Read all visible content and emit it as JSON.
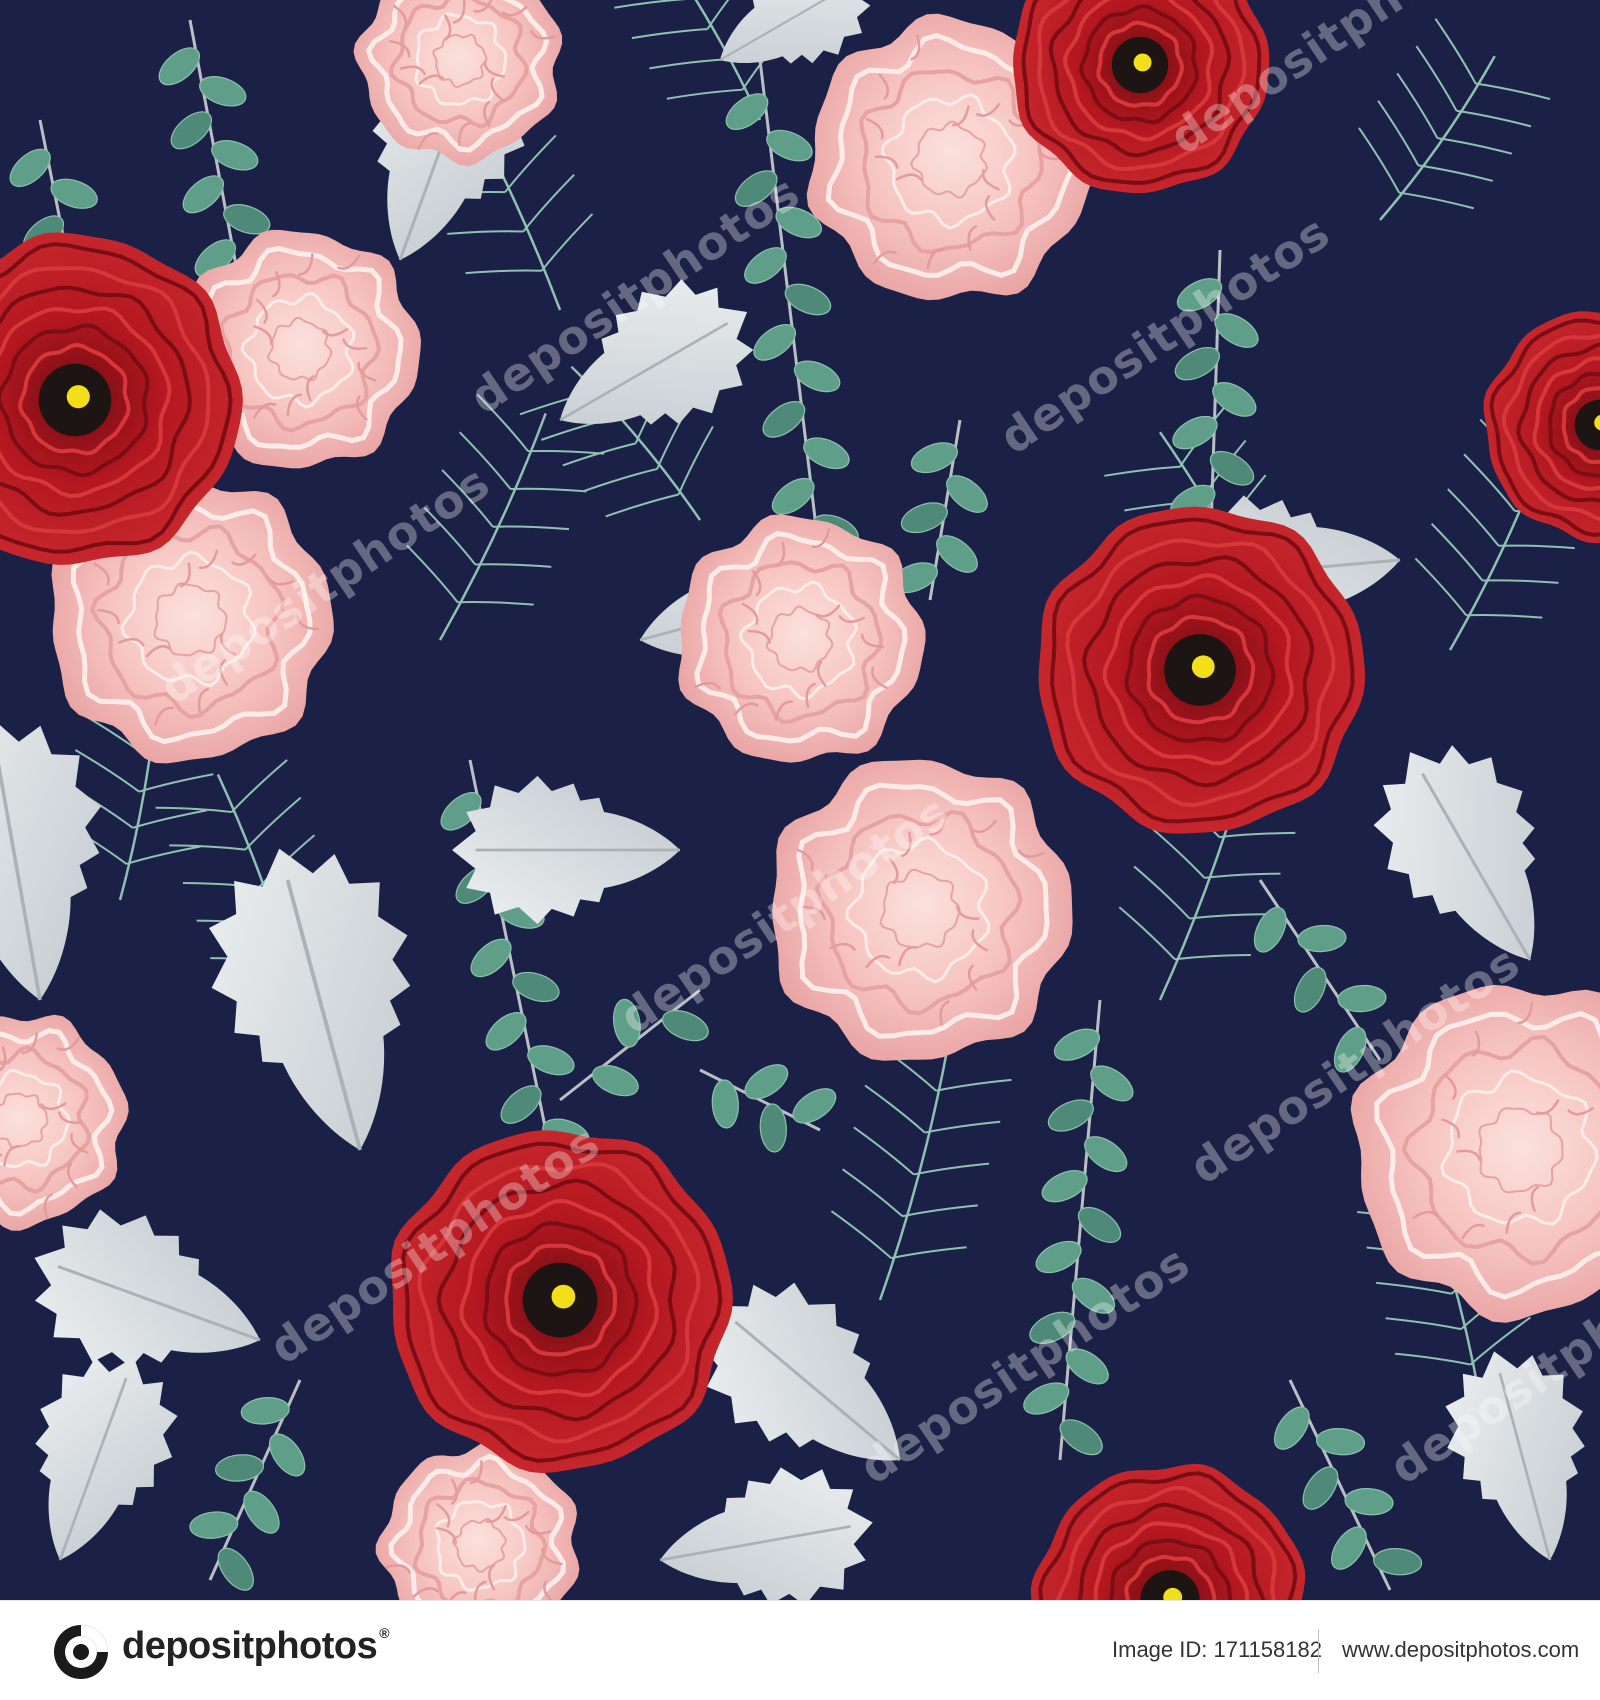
{
  "footer": {
    "brand": "depositphotos",
    "brand_mark": "®",
    "image_id": "Image ID: 171158182",
    "website": "www.depositphotos.com"
  },
  "watermark": {
    "text": "depositphotos"
  },
  "palette": {
    "background": "#1b2146",
    "carnation_pink": "#f6c3c0",
    "ranunculus_red": "#b3171f",
    "eucalyptus": "#5f9e88",
    "dusty_miller": "#d9dde0"
  },
  "pattern": {
    "subjects": [
      "red-ranunculus",
      "pink-carnation",
      "eucalyptus-stem",
      "dusty-miller-leaf",
      "fern-sprig"
    ]
  }
}
